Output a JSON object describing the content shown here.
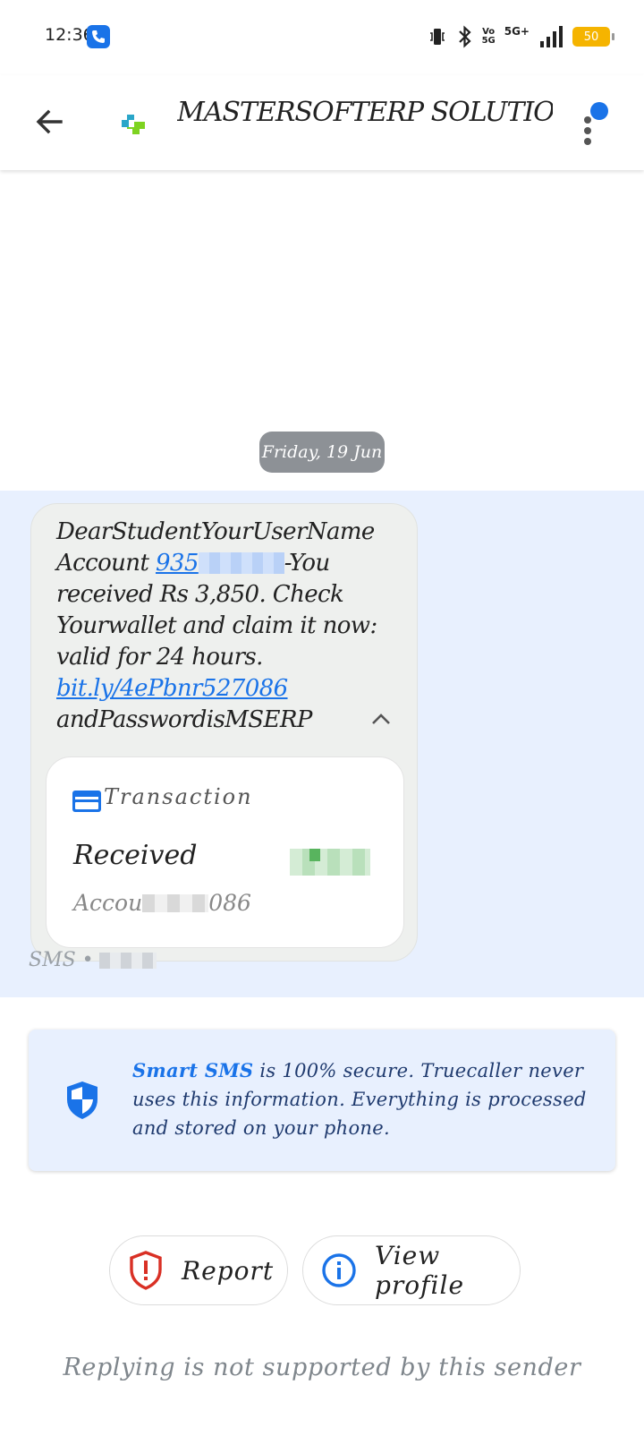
{
  "status_bar": {
    "time": "12:36",
    "volte_label": "Vo\n5G",
    "network_label": "5G+",
    "battery_level": "50"
  },
  "app_bar": {
    "title": "MASTERSOFTERP SOLUTIONS PVT LTD",
    "has_notification": true
  },
  "conversation": {
    "date_chip": "Friday, 19 Jun",
    "message": {
      "text_part1": "DearStudentYourUserName Account ",
      "account_link": "935",
      "text_part2": "-You received Rs 3,850. Check Yourwallet and claim it now: valid for 24 hours. ",
      "url_link": "bit.ly/4ePbnr527086",
      "text_part3": " andPasswordisMSERP"
    },
    "transaction": {
      "label": "Transaction",
      "type": "Received",
      "account_prefix": "Accou",
      "account_suffix": "086"
    },
    "meta_label": "SMS •"
  },
  "secure_notice": {
    "brand": "Smart SMS",
    "text": " is 100% secure. Truecaller never uses this information. Everything is processed and stored on your phone."
  },
  "actions": {
    "report_label": "Report",
    "view_profile_label": "View profile"
  },
  "footer_note": "Replying is not supported by this sender",
  "colors": {
    "accent": "#1a73e8",
    "message_area_bg": "#e8f0fe",
    "bubble_bg": "#eef0ee",
    "report_red": "#d93025"
  }
}
